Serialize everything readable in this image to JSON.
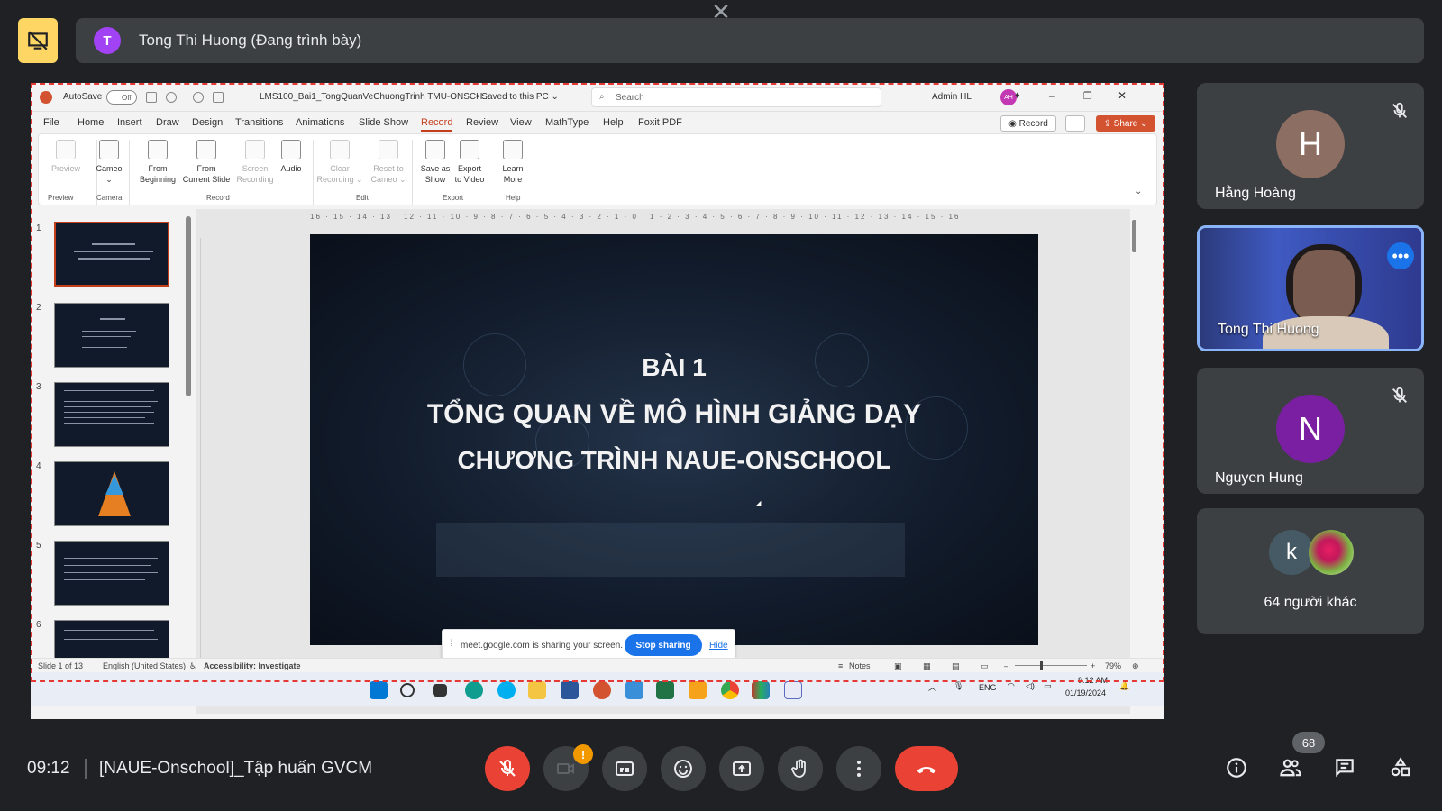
{
  "presenter": {
    "avatar_letter": "T",
    "label": "Tong Thi Huong (Đang trình bày)"
  },
  "shared_screen": {
    "titlebar": {
      "autosave": "AutoSave",
      "autosave_state": "Off",
      "filename": "LMS100_Bai1_TongQuanVeChuongTrinh TMU-ONSCH...",
      "saved": "• Saved to this PC ⌄",
      "search_placeholder": "Search",
      "user": "Admin HL",
      "user_initials": "AH"
    },
    "menu": [
      "File",
      "Home",
      "Insert",
      "Draw",
      "Design",
      "Transitions",
      "Animations",
      "Slide Show",
      "Record",
      "Review",
      "View",
      "MathType",
      "Help",
      "Foxit PDF"
    ],
    "record_button": "Record",
    "share_button": "Share",
    "ribbon": {
      "preview": "Preview",
      "cameo": "Cameo",
      "from_beginning": [
        "From",
        "Beginning"
      ],
      "from_current": [
        "From",
        "Current Slide"
      ],
      "screen_recording": [
        "Screen",
        "Recording"
      ],
      "audio": "Audio",
      "clear_recording": [
        "Clear",
        "Recording ⌄"
      ],
      "reset_cameo": [
        "Reset to",
        "Cameo ⌄"
      ],
      "save_as_show": [
        "Save as",
        "Show"
      ],
      "export_video": [
        "Export",
        "to Video"
      ],
      "learn_more": [
        "Learn",
        "More"
      ],
      "groups": [
        "Preview",
        "Camera",
        "Record",
        "Edit",
        "Export",
        "Help"
      ]
    },
    "slide_numbers": [
      "1",
      "2",
      "3",
      "4",
      "5",
      "6"
    ],
    "ruler_top": "16 · 15 · 14 · 13 · 12 · 11 · 10 · 9 · 8 · 7 · 6 · 5 · 4 · 3 · 2 · 1 · 0 · 1 · 2 · 3 · 4 · 5 · 6 · 7 · 8 · 9 · 10 · 11 · 12 · 13 · 14 · 15 · 16",
    "slide": {
      "line1": "BÀI 1",
      "line2": "TỔNG QUAN VỀ MÔ HÌNH GIẢNG DẠY",
      "line3": "CHƯƠNG TRÌNH NAUE-ONSCHOOL"
    },
    "sharing_bar": {
      "message": "meet.google.com is sharing your screen.",
      "stop": "Stop sharing",
      "hide": "Hide"
    },
    "status": {
      "slide": "Slide 1 of 13",
      "language": "English (United States)",
      "accessibility": "Accessibility: Investigate",
      "notes": "Notes",
      "zoom": "79%"
    },
    "taskbar": {
      "lang": "ENG",
      "time": "9:12 AM",
      "date": "01/19/2024"
    }
  },
  "participants": [
    {
      "letter": "H",
      "name": "Hằng Hoàng",
      "color": "#8d6e63"
    },
    {
      "name": "Tong Thi Huong"
    },
    {
      "letter": "N",
      "name": "Nguyen Hung",
      "color": "#7b1fa2"
    },
    {
      "letter": "k",
      "others": "64 người khác"
    }
  ],
  "bottom": {
    "time": "09:12",
    "title": "[NAUE-Onschool]_Tập huấn GVCM",
    "camera_alert": "!",
    "people_count": "68"
  },
  "colors": {
    "accent": "#1a73e8",
    "end_call": "#ea4335",
    "present_badge": "#fdd663",
    "share_border": "#e53935"
  }
}
